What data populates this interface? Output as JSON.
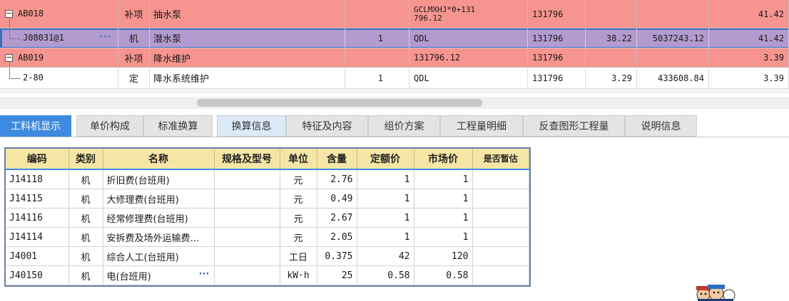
{
  "upper_rows": [
    {
      "kind": "parent",
      "color": "#f6948f",
      "expander": "−",
      "code": "AB018",
      "type": "补项",
      "name": "抽水泵",
      "qty": "",
      "unit_line1": "GCLMXHJ*0+131",
      "unit_line2": "796.12",
      "quantity": "131796",
      "price": "",
      "total": "",
      "col8": "41.42"
    },
    {
      "kind": "child",
      "color": "#b39bcf",
      "code": "J08031@1",
      "ellipsis": "···",
      "type": "机",
      "name": "潜水泵",
      "qty": "1",
      "unit": "QDL",
      "quantity": "131796",
      "price": "38.22",
      "total": "5037243.12",
      "col8": "41.42"
    },
    {
      "kind": "parent",
      "color": "#f6948f",
      "expander": "−",
      "code": "AB019",
      "type": "补项",
      "name": "降水维护",
      "qty": "",
      "unit": "131796.12",
      "quantity": "131796",
      "price": "",
      "total": "",
      "col8": "3.39"
    },
    {
      "kind": "child",
      "color": "#ffffff",
      "code": "2-80",
      "type": "定",
      "name": "降水系统维护",
      "qty": "1",
      "unit": "QDL",
      "quantity": "131796",
      "price": "3.29",
      "total": "433608.84",
      "col8": "3.39"
    }
  ],
  "tabs": [
    {
      "label": "工料机显示",
      "state": "active"
    },
    {
      "label": "单价构成",
      "state": "normal"
    },
    {
      "label": "标准换算",
      "state": "normal"
    },
    {
      "label": "换算信息",
      "state": "light"
    },
    {
      "label": "特征及内容",
      "state": "normal"
    },
    {
      "label": "组价方案",
      "state": "normal"
    },
    {
      "label": "工程量明细",
      "state": "normal"
    },
    {
      "label": "反查图形工程量",
      "state": "normal"
    },
    {
      "label": "说明信息",
      "state": "normal"
    }
  ],
  "lower_table": {
    "headers": [
      "编码",
      "类别",
      "名称",
      "规格及型号",
      "单位",
      "含量",
      "定额价",
      "市场价",
      "是否暂估"
    ],
    "rows": [
      {
        "code": "J14118",
        "type": "机",
        "name": "折旧费(台班用)",
        "spec": "",
        "unit": "元",
        "content": "2.76",
        "base": "1",
        "market": "1",
        "est": ""
      },
      {
        "code": "J14115",
        "type": "机",
        "name": "大修理费(台班用)",
        "spec": "",
        "unit": "元",
        "content": "0.49",
        "base": "1",
        "market": "1",
        "est": ""
      },
      {
        "code": "J14116",
        "type": "机",
        "name": "经常修理费(台班用)",
        "spec": "",
        "unit": "元",
        "content": "2.67",
        "base": "1",
        "market": "1",
        "est": ""
      },
      {
        "code": "J14114",
        "type": "机",
        "name": "安拆费及场外运输费…",
        "spec": "",
        "unit": "元",
        "content": "2.05",
        "base": "1",
        "market": "1",
        "est": ""
      },
      {
        "code": "J4001",
        "type": "机",
        "name": "综合人工(台班用)",
        "spec": "",
        "unit": "工日",
        "content": "0.375",
        "base": "42",
        "market": "120",
        "est": ""
      },
      {
        "code": "J40150",
        "type": "机",
        "name": "电(台班用)",
        "name_ellipsis": "···",
        "spec": "",
        "unit": "kW·h",
        "content": "25",
        "base": "0.58",
        "market": "0.58",
        "est": ""
      }
    ]
  },
  "colors": {
    "accent": "#3d8ae0",
    "parent_row": "#f6948f",
    "selected_row": "#b39bcf",
    "header": "#f6e6a6"
  }
}
